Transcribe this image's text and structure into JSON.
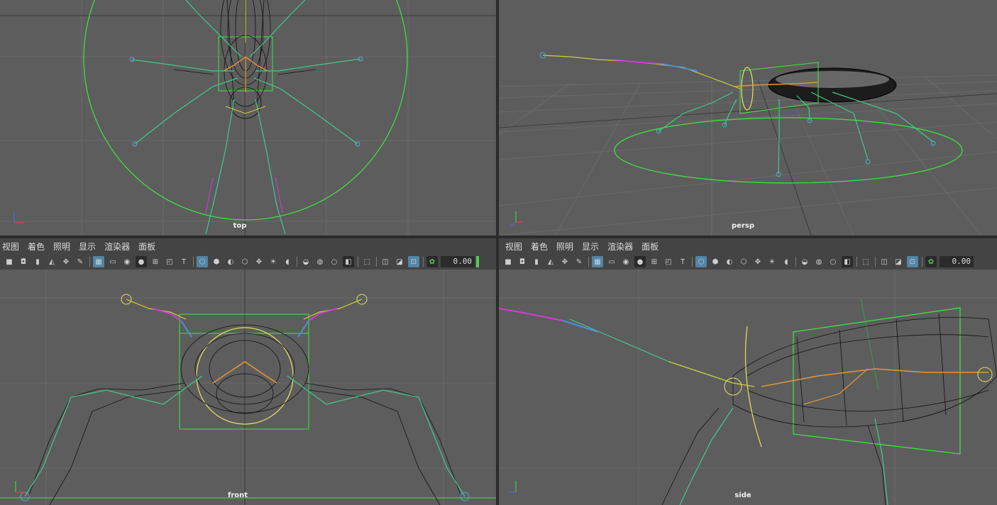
{
  "viewports": {
    "top": {
      "label": "top"
    },
    "persp": {
      "label": "persp"
    },
    "front": {
      "label": "front"
    },
    "side": {
      "label": "side"
    }
  },
  "panel_menu": [
    "视图",
    "着色",
    "照明",
    "显示",
    "渲染器",
    "面板"
  ],
  "toolbar": {
    "icons": [
      "camera-icon",
      "camera-attributes-icon",
      "bookmark-icon",
      "image-plane-icon",
      "2d-pan-zoom-icon",
      "grease-pencil-icon",
      "grid-icon",
      "film-gate-icon",
      "resolution-gate-icon",
      "gate-mask-icon",
      "field-chart-icon",
      "safe-action-icon",
      "safe-title-icon",
      "wireframe-icon",
      "smooth-shade-icon",
      "default-material-icon",
      "wireframe-on-shaded-icon",
      "textured-icon",
      "use-all-lights-icon",
      "shadows-icon",
      "screen-space-ambient-occlusion-icon",
      "motion-blur-icon",
      "multisample-anti-aliasing-icon",
      "depth-of-field-icon",
      "isolate-select-icon",
      "xray-icon",
      "xray-active-components-icon",
      "xray-joints-icon",
      "camera-exposure-icon"
    ],
    "exposure_value": "0.00"
  },
  "colors": {
    "grid": "#6b6b6b",
    "axis": "#3d3d3d",
    "ctrl": "#38e838",
    "select": "#e8e060",
    "wire": "#111111"
  }
}
